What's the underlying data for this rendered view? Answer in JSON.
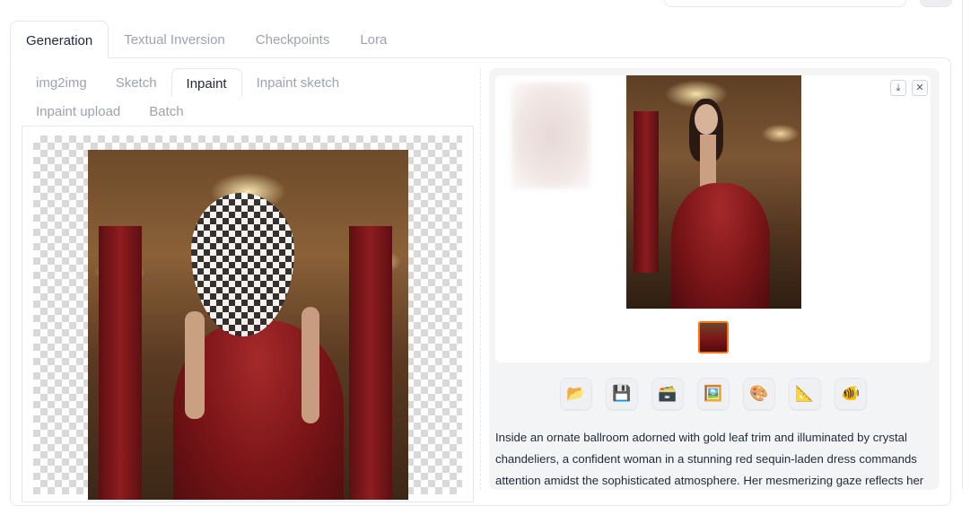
{
  "main_tabs": [
    {
      "label": "Generation",
      "active": true
    },
    {
      "label": "Textual Inversion",
      "active": false
    },
    {
      "label": "Checkpoints",
      "active": false
    },
    {
      "label": "Lora",
      "active": false
    }
  ],
  "sub_tabs_row1": [
    {
      "label": "img2img",
      "active": false
    },
    {
      "label": "Sketch",
      "active": false
    },
    {
      "label": "Inpaint",
      "active": true
    },
    {
      "label": "Inpaint sketch",
      "active": false
    }
  ],
  "sub_tabs_row2": [
    {
      "label": "Inpaint upload",
      "active": false
    },
    {
      "label": "Batch",
      "active": false
    }
  ],
  "gallery": {
    "download_icon": "download-icon",
    "close_icon": "close-icon",
    "thumbnail_count": 1
  },
  "tools": [
    {
      "icon": "📂",
      "name": "open-folder"
    },
    {
      "icon": "💾",
      "name": "save"
    },
    {
      "icon": "🗃️",
      "name": "zip-archive"
    },
    {
      "icon": "🖼️",
      "name": "send-to-img2img"
    },
    {
      "icon": "🎨",
      "name": "send-to-inpaint"
    },
    {
      "icon": "📐",
      "name": "send-to-extras"
    },
    {
      "icon": "🐠",
      "name": "other-tool"
    }
  ],
  "output_info": {
    "line1": "Inside an ornate ballroom adorned with gold leaf trim and illuminated by crystal",
    "line2": "chandeliers, a confident woman in a stunning red sequin-laden dress commands",
    "line3": "attention amidst the sophisticated atmosphere. Her mesmerizing gaze reflects her"
  },
  "colors": {
    "accent_selected": "#f97316",
    "border": "#e5e7eb",
    "inactive_tab_text": "#9ca3af"
  }
}
